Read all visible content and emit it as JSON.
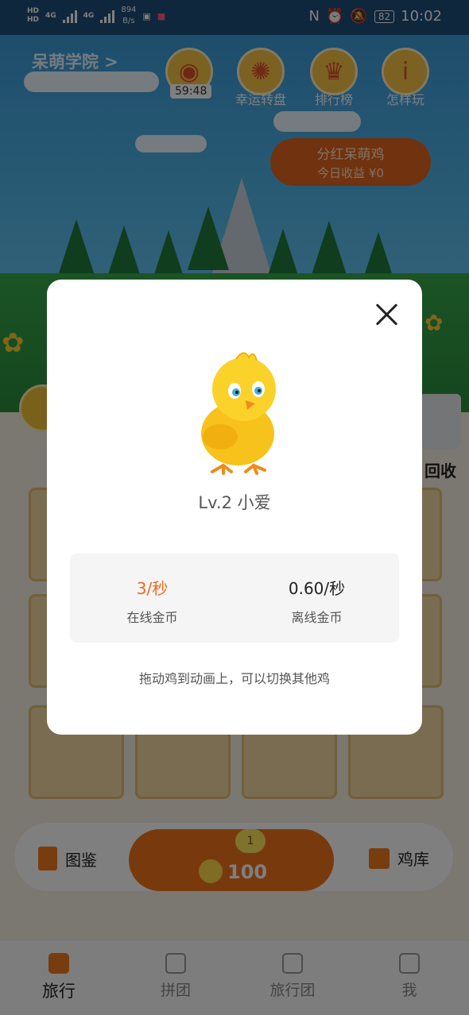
{
  "status_bar": {
    "hd_top": "HD",
    "hd_bottom": "HD",
    "sim1": "4G",
    "sim2": "4G",
    "net_speed": "894",
    "net_unit": "B/s",
    "battery": "82",
    "time": "10:02"
  },
  "game": {
    "academy_title": "呆萌学院 >",
    "timer": "59:48",
    "top_buttons": [
      {
        "label": "幸运转盘",
        "icon": "wheel-icon"
      },
      {
        "label": "排行榜",
        "icon": "trophy-icon"
      },
      {
        "label": "怎样玩",
        "icon": "info-icon"
      }
    ],
    "bonus": {
      "title": "分红呆萌鸡",
      "subtitle": "今日收益 ¥0"
    },
    "recycle_label": "回收",
    "left_button_label": "图鉴",
    "right_button_label": "鸡库",
    "buy_level": "1",
    "buy_price": "100"
  },
  "tabs": [
    {
      "label": "旅行",
      "active": true
    },
    {
      "label": "拼团",
      "active": false
    },
    {
      "label": "旅行团",
      "active": false
    },
    {
      "label": "我",
      "active": false
    }
  ],
  "modal": {
    "chick_name": "Lv.2 小爱",
    "online_value": "3/秒",
    "online_label": "在线金币",
    "offline_value": "0.60/秒",
    "offline_label": "离线金币",
    "hint": "拖动鸡到动画上，可以切换其他鸡"
  },
  "colors": {
    "accent_orange": "#ee6a1f",
    "modal_bg": "#ffffff",
    "overlay": "rgba(0,0,0,0.5)"
  }
}
